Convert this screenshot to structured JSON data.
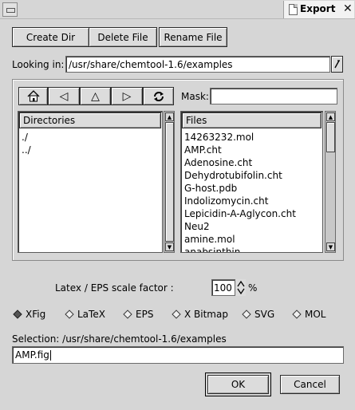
{
  "window": {
    "title": "Export",
    "close_glyph": "✕",
    "menu_icon": "window-menu-icon",
    "doc_icon": "document-icon"
  },
  "toolbar": {
    "create_dir": "Create Dir",
    "delete_file": "Delete File",
    "rename_file": "Rename File"
  },
  "location": {
    "label": "Looking in:",
    "path": "/usr/share/chemtool-1.6/examples",
    "arrow_icon": "combo-dropdown-icon"
  },
  "nav": {
    "home_icon": "home-icon",
    "back_icon": "back-arrow-icon",
    "up_icon": "up-arrow-icon",
    "forward_icon": "forward-arrow-icon",
    "refresh_icon": "refresh-icon",
    "back_glyph": "◁",
    "up_glyph": "△",
    "forward_glyph": "▷"
  },
  "mask": {
    "label": "Mask:",
    "value": ""
  },
  "directories": {
    "header": "Directories",
    "items": [
      "./",
      "../"
    ]
  },
  "files": {
    "header": "Files",
    "items": [
      "14263232.mol",
      "AMP.cht",
      "Adenosine.cht",
      "Dehydrotubifolin.cht",
      "G-host.pdb",
      "Indolizomycin.cht",
      "Lepicidin-A-Aglycon.cht",
      "Neu2",
      "amine.mol",
      "anabsinthin"
    ]
  },
  "scale": {
    "label": "Latex / EPS scale factor :",
    "value": "100",
    "unit": "%"
  },
  "formats": {
    "selected": "XFig",
    "options": [
      "XFig",
      "LaTeX",
      "EPS",
      "X Bitmap",
      "SVG",
      "MOL"
    ]
  },
  "selection": {
    "label": "Selection: /usr/share/chemtool-1.6/examples",
    "value": "AMP.fig"
  },
  "actions": {
    "ok": "OK",
    "cancel": "Cancel"
  }
}
